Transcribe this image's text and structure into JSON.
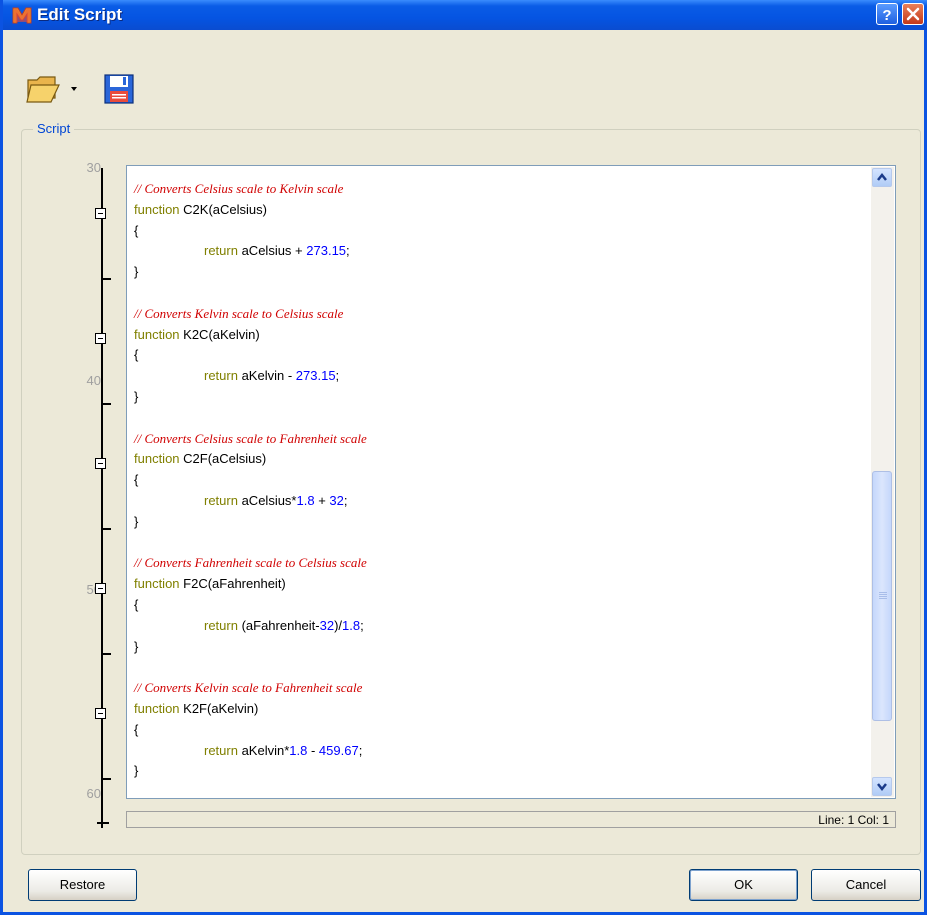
{
  "window": {
    "title": "Edit Script",
    "help_label": "?",
    "close_label": "X"
  },
  "toolbar": {
    "open_icon": "folder-open-icon",
    "save_icon": "floppy-save-icon"
  },
  "group_label": "Script",
  "line_numbers": [
    "30",
    "40",
    "50",
    "60"
  ],
  "code_lines": [
    [
      {
        "t": "// Converts Celsius scale to Kelvin scale",
        "c": "cm"
      }
    ],
    [
      {
        "t": "function",
        "c": "kw"
      },
      {
        "t": " C2K(aCelsius)",
        "c": ""
      }
    ],
    [
      {
        "t": "{",
        "c": ""
      }
    ],
    [
      {
        "t": "",
        "c": "ind"
      },
      {
        "t": "return",
        "c": "kw"
      },
      {
        "t": " aCelsius + ",
        "c": ""
      },
      {
        "t": "273.15",
        "c": "nm"
      },
      {
        "t": ";",
        "c": ""
      }
    ],
    [
      {
        "t": "}",
        "c": ""
      }
    ],
    [
      {
        "t": "",
        "c": ""
      }
    ],
    [
      {
        "t": "// Converts Kelvin scale to Celsius scale",
        "c": "cm"
      }
    ],
    [
      {
        "t": "function",
        "c": "kw"
      },
      {
        "t": " K2C(aKelvin)",
        "c": ""
      }
    ],
    [
      {
        "t": "{",
        "c": ""
      }
    ],
    [
      {
        "t": "",
        "c": "ind"
      },
      {
        "t": "return",
        "c": "kw"
      },
      {
        "t": " aKelvin - ",
        "c": ""
      },
      {
        "t": "273.15",
        "c": "nm"
      },
      {
        "t": ";",
        "c": ""
      }
    ],
    [
      {
        "t": "}",
        "c": ""
      }
    ],
    [
      {
        "t": "",
        "c": ""
      }
    ],
    [
      {
        "t": "// Converts Celsius scale to Fahrenheit scale",
        "c": "cm"
      }
    ],
    [
      {
        "t": "function",
        "c": "kw"
      },
      {
        "t": " C2F(aCelsius)",
        "c": ""
      }
    ],
    [
      {
        "t": "{",
        "c": ""
      }
    ],
    [
      {
        "t": "",
        "c": "ind"
      },
      {
        "t": "return",
        "c": "kw"
      },
      {
        "t": " aCelsius*",
        "c": ""
      },
      {
        "t": "1.8",
        "c": "nm"
      },
      {
        "t": " + ",
        "c": ""
      },
      {
        "t": "32",
        "c": "nm"
      },
      {
        "t": ";",
        "c": ""
      }
    ],
    [
      {
        "t": "}",
        "c": ""
      }
    ],
    [
      {
        "t": "",
        "c": ""
      }
    ],
    [
      {
        "t": "// Converts Fahrenheit scale to Celsius scale",
        "c": "cm"
      }
    ],
    [
      {
        "t": "function",
        "c": "kw"
      },
      {
        "t": " F2C(aFahrenheit)",
        "c": ""
      }
    ],
    [
      {
        "t": "{",
        "c": ""
      }
    ],
    [
      {
        "t": "",
        "c": "ind"
      },
      {
        "t": "return",
        "c": "kw"
      },
      {
        "t": " (aFahrenheit-",
        "c": ""
      },
      {
        "t": "32",
        "c": "nm"
      },
      {
        "t": ")/",
        "c": ""
      },
      {
        "t": "1.8",
        "c": "nm"
      },
      {
        "t": ";",
        "c": ""
      }
    ],
    [
      {
        "t": "}",
        "c": ""
      }
    ],
    [
      {
        "t": "",
        "c": ""
      }
    ],
    [
      {
        "t": "// Converts Kelvin scale to Fahrenheit scale",
        "c": "cm"
      }
    ],
    [
      {
        "t": "function",
        "c": "kw"
      },
      {
        "t": " K2F(aKelvin)",
        "c": ""
      }
    ],
    [
      {
        "t": "{",
        "c": ""
      }
    ],
    [
      {
        "t": "",
        "c": "ind"
      },
      {
        "t": "return",
        "c": "kw"
      },
      {
        "t": " aKelvin*",
        "c": ""
      },
      {
        "t": "1.8",
        "c": "nm"
      },
      {
        "t": " - ",
        "c": ""
      },
      {
        "t": "459.67",
        "c": "nm"
      },
      {
        "t": ";",
        "c": ""
      }
    ],
    [
      {
        "t": "}",
        "c": ""
      }
    ]
  ],
  "status": "Line: 1 Col: 1",
  "buttons": {
    "restore": "Restore",
    "ok": "OK",
    "cancel": "Cancel"
  },
  "colors": {
    "comment": "#d00000",
    "keyword": "#808000",
    "number": "#0000ff",
    "titlebar": "#0554e2"
  }
}
